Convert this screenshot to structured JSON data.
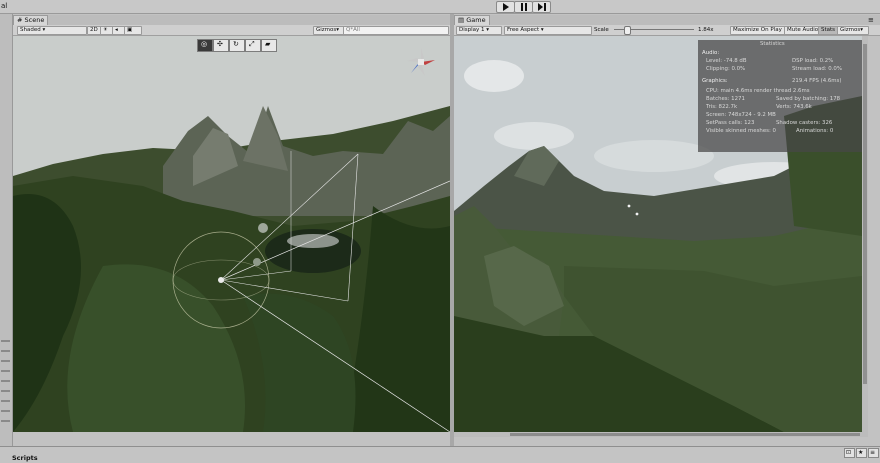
{
  "app": {
    "window_title": "al"
  },
  "toolbar": {
    "play_icon": "play-icon",
    "pause_icon": "pause-icon",
    "step_icon": "step-icon"
  },
  "scene": {
    "tab_label": "Scene",
    "shading_mode": "Shaded",
    "mode_2d": "2D",
    "gizmos_label": "Gizmos",
    "search_placeholder": "Q*All"
  },
  "game": {
    "tab_label": "Game",
    "display": "Display 1",
    "aspect": "Free Aspect",
    "scale_label": "Scale",
    "scale_value": "1.84x",
    "maximize_on_play": "Maximize On Play",
    "mute_audio": "Mute Audio",
    "stats_label": "Stats",
    "gizmos_label": "Gizmos"
  },
  "stats": {
    "title": "Statistics",
    "audio_header": "Audio:",
    "level": "Level: -74.8 dB",
    "dsp_load": "DSP load: 0.2%",
    "clipping": "Clipping: 0.0%",
    "stream_load": "Stream load: 0.0%",
    "graphics_header": "Graphics:",
    "fps": "219.4 FPS (4.6ms)",
    "cpu": "CPU: main 4.6ms  render thread 2.6ms",
    "batches": "Batches: 1271",
    "saved_batching": "Saved by batching: 178",
    "tris": "Tris: 822.7k",
    "verts": "Verts: 743.6k",
    "screen": "Screen: 748x724 - 9.2 MB",
    "setpass": "SetPass calls: 123",
    "shadow_casters": "Shadow casters: 326",
    "skinned": "Visible skinned meshes: 0",
    "animations": "Animations: 0"
  },
  "bottom": {
    "project_label": "Scripts"
  },
  "colors": {
    "editor_bg": "#c2c2c2",
    "sky": "#c9cfd1",
    "grass": "#354a22",
    "mountain": "#5d6656",
    "stats_bg": "#4a4a4a"
  }
}
